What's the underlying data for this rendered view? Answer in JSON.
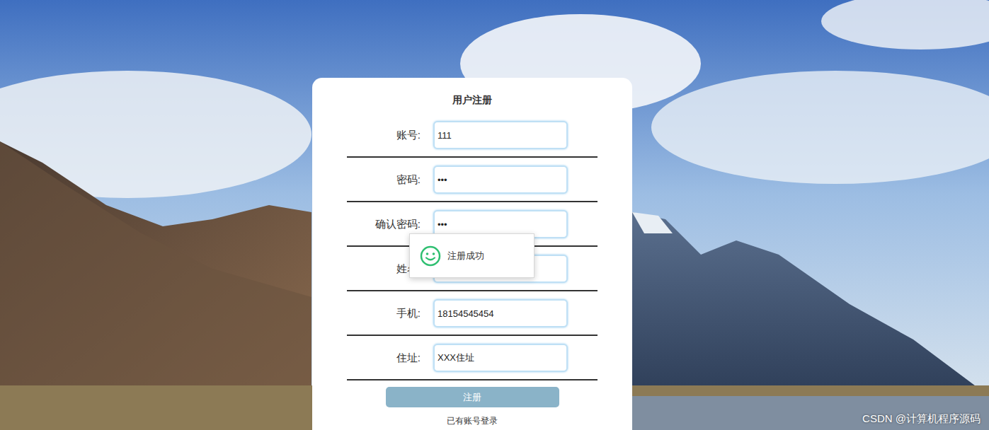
{
  "form": {
    "title": "用户注册",
    "fields": [
      {
        "label": "账号:",
        "value": "111"
      },
      {
        "label": "密码:",
        "value": "•••"
      },
      {
        "label": "确认密码:",
        "value": "•••"
      },
      {
        "label": "姓名:",
        "value": ""
      },
      {
        "label": "手机:",
        "value": "18154545454"
      },
      {
        "label": "住址:",
        "value": "XXX住址"
      }
    ],
    "submit": "注册",
    "login_link": "已有账号登录"
  },
  "toast": {
    "message": "注册成功"
  },
  "watermark": "CSDN @计算机程序源码"
}
